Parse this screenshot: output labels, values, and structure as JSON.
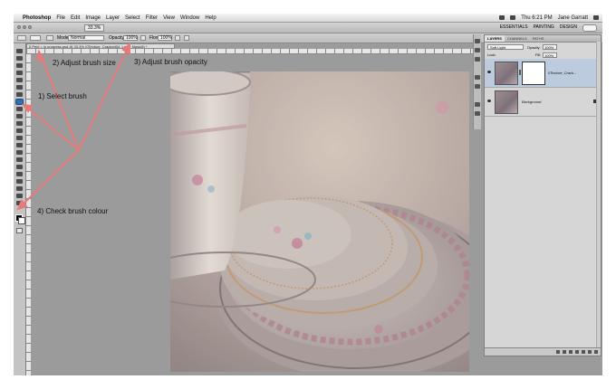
{
  "menubar": {
    "app_name": "Photoshop",
    "items": [
      "File",
      "Edit",
      "Image",
      "Layer",
      "Select",
      "Filter",
      "View",
      "Window",
      "Help"
    ],
    "clock": "Thu 6:21 PM",
    "user": "Jane Garratt"
  },
  "appbar": {
    "zoom": "33.3%",
    "workspaces": [
      "ESSENTIALS",
      "PAINTING",
      "DESIGN"
    ]
  },
  "options_bar": {
    "mode_label": "Mode:",
    "mode_value": "Normal",
    "opacity_label": "Opacity:",
    "opacity_value": "100%",
    "flow_label": "Flow:",
    "flow_value": "100%"
  },
  "document": {
    "tab_title": "0 Peril = in progress.psd @ 33.3% (0Texture_Cracked04, Layer Mask/8) *"
  },
  "layers_panel": {
    "tabs": [
      "LAYERS",
      "CHANNELS",
      "PATHS"
    ],
    "blend_mode": "Soft Light",
    "opacity_label": "Opacity:",
    "opacity_value": "100%",
    "lock_label": "Lock:",
    "fill_label": "Fill:",
    "fill_value": "100%",
    "layers": [
      {
        "name": "0Texture_Crack..."
      },
      {
        "name": "Background"
      }
    ]
  },
  "annotations": {
    "select_brush": "1) Select brush",
    "adjust_size": "2) Adjust brush size",
    "adjust_opacity": "3) Adjust brush opacity",
    "check_colour": "4) Check brush colour"
  },
  "colors": {
    "arrow": "#e77a7a",
    "canvas_bg": "#9b9b9b",
    "active_tool": "#2c6fb3"
  },
  "icons": [
    "apple-icon",
    "wifi-icon",
    "battery-icon",
    "search-icon",
    "brush-tool-icon",
    "eye-icon",
    "lock-icon",
    "link-icon"
  ]
}
